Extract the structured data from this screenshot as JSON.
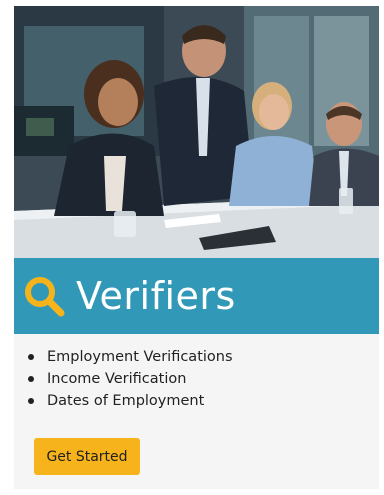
{
  "card": {
    "title": "Verifiers",
    "icon": "search-icon",
    "accent_color": "#3199b7",
    "icon_color": "#f7b31b",
    "features": [
      "Employment Verifications",
      "Income Verification",
      "Dates of Employment"
    ],
    "cta_label": "Get Started",
    "cta_color": "#f7b31b"
  }
}
